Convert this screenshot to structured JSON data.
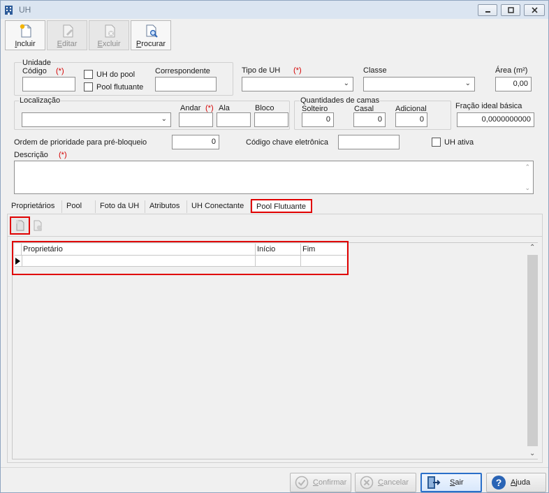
{
  "window": {
    "title": "UH"
  },
  "toolbar": {
    "incluir": "Incluir",
    "editar": "Editar",
    "excluir": "Excluir",
    "procurar": "Procurar"
  },
  "form": {
    "unidade_label": "Unidade",
    "codigo_label": "Código",
    "req_mark": "(*)",
    "uh_do_pool_label": "UH do pool",
    "pool_flutuante_label": "Pool flutuante",
    "correspondente_label": "Correspondente",
    "tipo_uh_label": "Tipo de UH",
    "classe_label": "Classe",
    "area_label": "Área (m²)",
    "area_value": "0,00",
    "localizacao_label": "Localização",
    "andar_label": "Andar",
    "ala_label": "Ala",
    "bloco_label": "Bloco",
    "qtd_camas_label": "Quantidades de camas",
    "solteiro_label": "Solteiro",
    "solteiro_value": "0",
    "casal_label": "Casal",
    "casal_value": "0",
    "adicional_label": "Adicional",
    "adicional_value": "0",
    "fracao_label": "Fração ideal básica",
    "fracao_value": "0,0000000000",
    "ordem_label": "Ordem de prioridade para pré-bloqueio",
    "ordem_value": "0",
    "codigo_chave_label": "Código chave eletrônica",
    "uh_ativa_label": "UH ativa",
    "descricao_label": "Descrição"
  },
  "tabs": [
    "Proprietários",
    "Pool",
    "Foto da UH",
    "Atributos",
    "UH Conectante",
    "Pool Flutuante"
  ],
  "grid": {
    "columns": [
      "Proprietário",
      "Início",
      "Fim"
    ]
  },
  "footer": {
    "confirmar": "Confirmar",
    "cancelar": "Cancelar",
    "sair": "Sair",
    "ajuda": "Ajuda"
  }
}
